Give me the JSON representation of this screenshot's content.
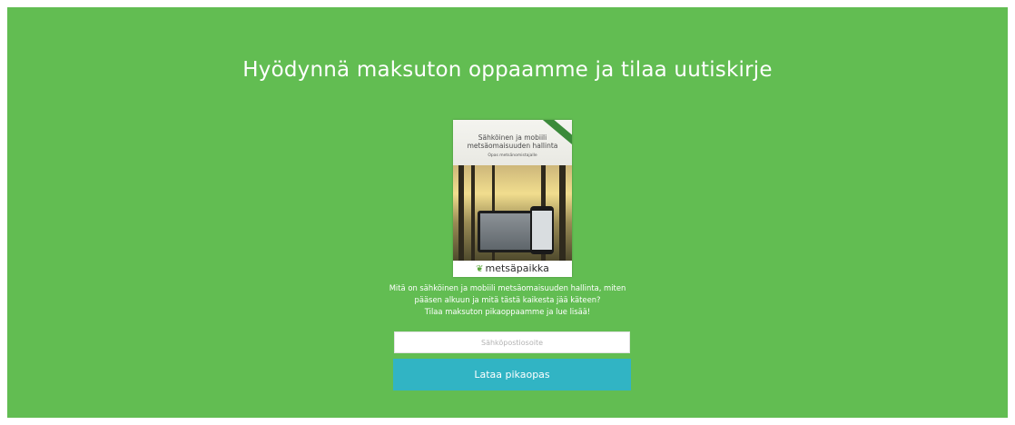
{
  "headline": "Hyödynnä maksuton oppaamme ja tilaa uutiskirje",
  "cover": {
    "title_line1": "Sähköinen ja mobiili",
    "title_line2": "metsäomaisuuden hallinta",
    "subtitle": "Opas metsänomistajalle",
    "brand": "metsäpaikka"
  },
  "description": {
    "line1": "Mitä on sähköinen ja mobiili metsäomaisuuden hallinta, miten",
    "line2": "pääsen alkuun ja mitä tästä kaikesta jää käteen?",
    "line3": "Tilaa maksuton pikaoppaamme ja lue lisää!"
  },
  "form": {
    "email_placeholder": "Sähköpostiosoite",
    "email_value": "",
    "submit_label": "Lataa pikaopas"
  },
  "colors": {
    "panel_bg": "#62bd52",
    "button_bg": "#31b4c4",
    "text": "#ffffff"
  }
}
